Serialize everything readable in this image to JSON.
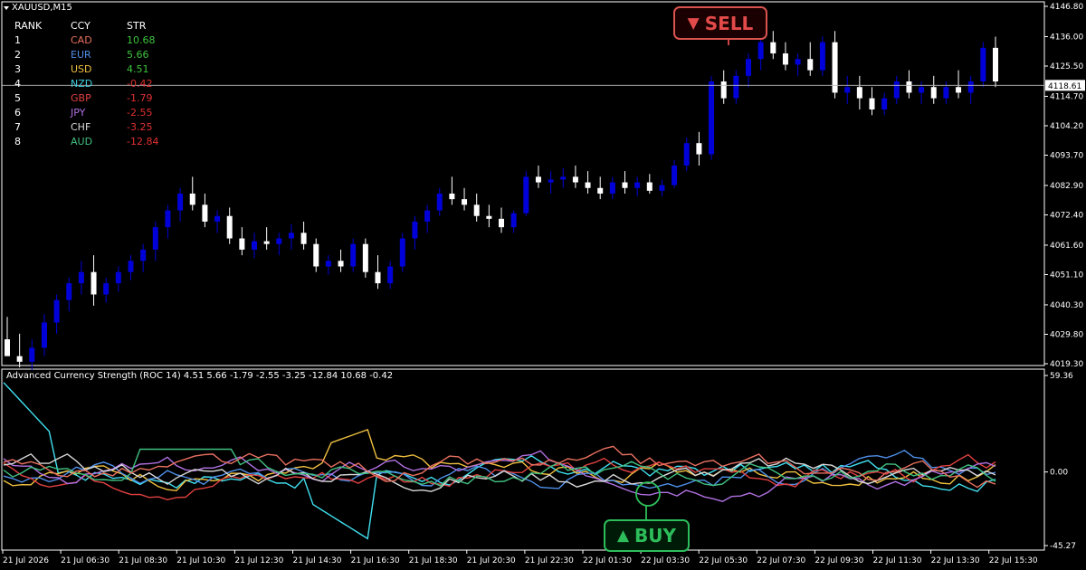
{
  "symbol": {
    "label": "XAUUSD,M15",
    "dropdown_icon": "triangle-down-icon"
  },
  "strength_table": {
    "headers": [
      "RANK",
      "CCY",
      "STR"
    ],
    "rows": [
      {
        "rank": "1",
        "ccy": "CAD",
        "str": "10.68",
        "ccy_color": "#e8705f",
        "str_color": "#3ec43e"
      },
      {
        "rank": "2",
        "ccy": "EUR",
        "str": "5.66",
        "ccy_color": "#4f8fe8",
        "str_color": "#3ec43e"
      },
      {
        "rank": "3",
        "ccy": "USD",
        "str": "4.51",
        "ccy_color": "#f0c040",
        "str_color": "#3ec43e"
      },
      {
        "rank": "4",
        "ccy": "NZD",
        "str": "-0.42",
        "ccy_color": "#40d0e0",
        "str_color": "#e03030"
      },
      {
        "rank": "5",
        "ccy": "GBP",
        "str": "-1.79",
        "ccy_color": "#e04040",
        "str_color": "#e03030"
      },
      {
        "rank": "6",
        "ccy": "JPY",
        "str": "-2.55",
        "ccy_color": "#b070e0",
        "str_color": "#e03030"
      },
      {
        "rank": "7",
        "ccy": "CHF",
        "str": "-3.25",
        "ccy_color": "#d8d8d8",
        "str_color": "#e03030"
      },
      {
        "rank": "8",
        "ccy": "AUD",
        "str": "-12.84",
        "ccy_color": "#40c080",
        "str_color": "#e03030"
      }
    ]
  },
  "price_axis": {
    "labels": [
      "4146.80",
      "4136.00",
      "4125.50",
      "4114.70",
      "4104.20",
      "4093.70",
      "4082.90",
      "4072.40",
      "4061.60",
      "4051.10",
      "4040.30",
      "4029.80",
      "4019.30"
    ],
    "max": 4146.8,
    "min": 4019.3,
    "current_price": "4118.61",
    "current_price_value": 4118.61
  },
  "candles": [
    [
      4028,
      4036,
      4024,
      4022
    ],
    [
      4022,
      4030,
      4018,
      4020
    ],
    [
      4020,
      4028,
      4017,
      4025
    ],
    [
      4025,
      4037,
      4022,
      4034
    ],
    [
      4034,
      4044,
      4030,
      4042
    ],
    [
      4042,
      4050,
      4038,
      4048
    ],
    [
      4048,
      4056,
      4044,
      4052
    ],
    [
      4052,
      4058,
      4040,
      4044
    ],
    [
      4044,
      4050,
      4041,
      4048
    ],
    [
      4048,
      4054,
      4045,
      4052
    ],
    [
      4052,
      4058,
      4049,
      4056
    ],
    [
      4056,
      4062,
      4052,
      4060
    ],
    [
      4060,
      4070,
      4056,
      4068
    ],
    [
      4068,
      4076,
      4064,
      4074
    ],
    [
      4074,
      4082,
      4070,
      4080
    ],
    [
      4080,
      4086,
      4074,
      4076
    ],
    [
      4076,
      4080,
      4068,
      4070
    ],
    [
      4070,
      4074,
      4066,
      4072
    ],
    [
      4072,
      4075,
      4062,
      4064
    ],
    [
      4064,
      4068,
      4058,
      4060
    ],
    [
      4060,
      4066,
      4057,
      4063
    ],
    [
      4063,
      4068,
      4060,
      4062
    ],
    [
      4062,
      4066,
      4058,
      4064
    ],
    [
      4064,
      4069,
      4060,
      4066
    ],
    [
      4066,
      4070,
      4060,
      4062
    ],
    [
      4062,
      4064,
      4052,
      4054
    ],
    [
      4054,
      4058,
      4051,
      4056
    ],
    [
      4056,
      4060,
      4052,
      4054
    ],
    [
      4054,
      4064,
      4052,
      4062
    ],
    [
      4062,
      4064,
      4050,
      4052
    ],
    [
      4052,
      4058,
      4046,
      4048
    ],
    [
      4048,
      4056,
      4046,
      4054
    ],
    [
      4054,
      4066,
      4052,
      4064
    ],
    [
      4064,
      4072,
      4060,
      4070
    ],
    [
      4070,
      4076,
      4066,
      4074
    ],
    [
      4074,
      4082,
      4072,
      4080
    ],
    [
      4080,
      4086,
      4076,
      4078
    ],
    [
      4078,
      4082,
      4074,
      4076
    ],
    [
      4076,
      4080,
      4070,
      4072
    ],
    [
      4072,
      4076,
      4068,
      4071
    ],
    [
      4071,
      4075,
      4066,
      4068
    ],
    [
      4068,
      4074,
      4066,
      4073
    ],
    [
      4073,
      4088,
      4072,
      4086
    ],
    [
      4086,
      4090,
      4082,
      4084
    ],
    [
      4084,
      4088,
      4080,
      4085
    ],
    [
      4085,
      4089,
      4082,
      4086
    ],
    [
      4086,
      4090,
      4082,
      4084
    ],
    [
      4084,
      4088,
      4080,
      4082
    ],
    [
      4082,
      4086,
      4078,
      4080
    ],
    [
      4080,
      4086,
      4078,
      4084
    ],
    [
      4084,
      4088,
      4080,
      4082
    ],
    [
      4082,
      4086,
      4079,
      4084
    ],
    [
      4084,
      4087,
      4080,
      4081
    ],
    [
      4081,
      4085,
      4079,
      4083
    ],
    [
      4083,
      4092,
      4082,
      4090
    ],
    [
      4090,
      4100,
      4088,
      4098
    ],
    [
      4098,
      4102,
      4090,
      4094
    ],
    [
      4094,
      4122,
      4092,
      4120
    ],
    [
      4120,
      4124,
      4112,
      4114
    ],
    [
      4114,
      4124,
      4112,
      4122
    ],
    [
      4122,
      4130,
      4118,
      4128
    ],
    [
      4128,
      4136,
      4124,
      4134
    ],
    [
      4134,
      4138,
      4128,
      4130
    ],
    [
      4130,
      4134,
      4124,
      4126
    ],
    [
      4126,
      4130,
      4122,
      4128
    ],
    [
      4128,
      4134,
      4122,
      4124
    ],
    [
      4124,
      4136,
      4122,
      4134
    ],
    [
      4134,
      4138,
      4114,
      4116
    ],
    [
      4116,
      4122,
      4112,
      4118
    ],
    [
      4118,
      4122,
      4110,
      4114
    ],
    [
      4114,
      4118,
      4108,
      4110
    ],
    [
      4110,
      4116,
      4108,
      4114
    ],
    [
      4114,
      4122,
      4112,
      4120
    ],
    [
      4120,
      4124,
      4114,
      4116
    ],
    [
      4116,
      4120,
      4112,
      4118
    ],
    [
      4118,
      4122,
      4112,
      4114
    ],
    [
      4114,
      4120,
      4112,
      4118
    ],
    [
      4118,
      4124,
      4114,
      4116
    ],
    [
      4116,
      4122,
      4112,
      4120
    ],
    [
      4120,
      4134,
      4118,
      4132
    ],
    [
      4132,
      4136,
      4118,
      4120
    ]
  ],
  "indicator": {
    "title": "Advanced Currency Strength (ROC 14) 4.51 5.66 -1.79 -2.55 -3.25 -12.84 10.68 -0.42",
    "axis_labels": [
      "59.36",
      "0.00",
      "-45.27"
    ],
    "max": 59.36,
    "min": -45.27,
    "series_colors": [
      "#40e0f0",
      "#f0c040",
      "#4f8fe8",
      "#e04040",
      "#b070e0",
      "#d8d8d8",
      "#40c080",
      "#e8705f"
    ]
  },
  "time_axis": {
    "labels": [
      "21 Jul 2026",
      "21 Jul 06:30",
      "21 Jul 08:30",
      "21 Jul 10:30",
      "21 Jul 12:30",
      "21 Jul 14:30",
      "21 Jul 16:30",
      "21 Jul 18:30",
      "21 Jul 20:30",
      "21 Jul 22:30",
      "22 Jul 01:30",
      "22 Jul 03:30",
      "22 Jul 05:30",
      "22 Jul 07:30",
      "22 Jul 09:30",
      "22 Jul 11:30",
      "22 Jul 13:30",
      "22 Jul 15:30"
    ]
  },
  "signals": {
    "sell": {
      "label": "SELL",
      "glyph": "▼",
      "color": "#e34a4a",
      "icon": "triangle-down-icon"
    },
    "buy": {
      "label": "BUY",
      "glyph": "▲",
      "color": "#2dbd5a",
      "icon": "triangle-up-icon"
    }
  },
  "colors": {
    "bull_candle": "#0000d8",
    "bear_candle": "#ffffff",
    "grid_line": "#ffffff"
  }
}
